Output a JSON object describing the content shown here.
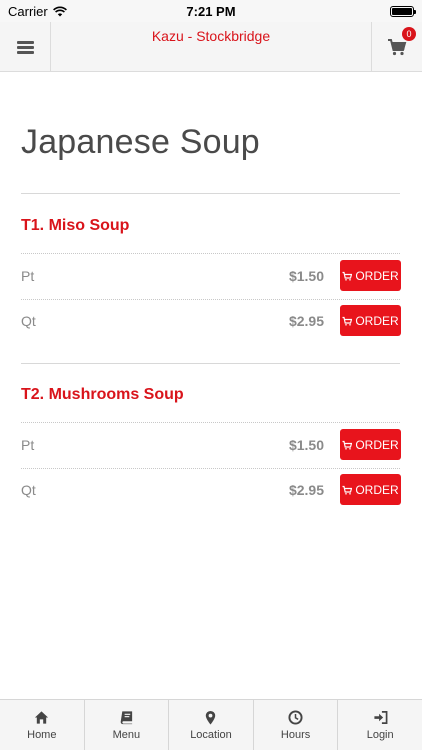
{
  "status_bar": {
    "carrier": "Carrier",
    "time": "7:21 PM"
  },
  "header": {
    "title": "Kazu - Stockbridge",
    "cart_count": "0"
  },
  "page": {
    "title": "Japanese Soup"
  },
  "items": [
    {
      "name": "T1. Miso Soup",
      "options": [
        {
          "size": "Pt",
          "price": "$1.50",
          "order_label": "ORDER"
        },
        {
          "size": "Qt",
          "price": "$2.95",
          "order_label": "ORDER"
        }
      ]
    },
    {
      "name": "T2. Mushrooms Soup",
      "options": [
        {
          "size": "Pt",
          "price": "$1.50",
          "order_label": "ORDER"
        },
        {
          "size": "Qt",
          "price": "$2.95",
          "order_label": "ORDER"
        }
      ]
    }
  ],
  "tabs": [
    {
      "label": "Home",
      "icon": "home-icon"
    },
    {
      "label": "Menu",
      "icon": "book-icon"
    },
    {
      "label": "Location",
      "icon": "location-pin-icon"
    },
    {
      "label": "Hours",
      "icon": "clock-icon"
    },
    {
      "label": "Login",
      "icon": "login-icon"
    }
  ],
  "colors": {
    "accent": "#e8141c",
    "title_red": "#d9141b"
  }
}
